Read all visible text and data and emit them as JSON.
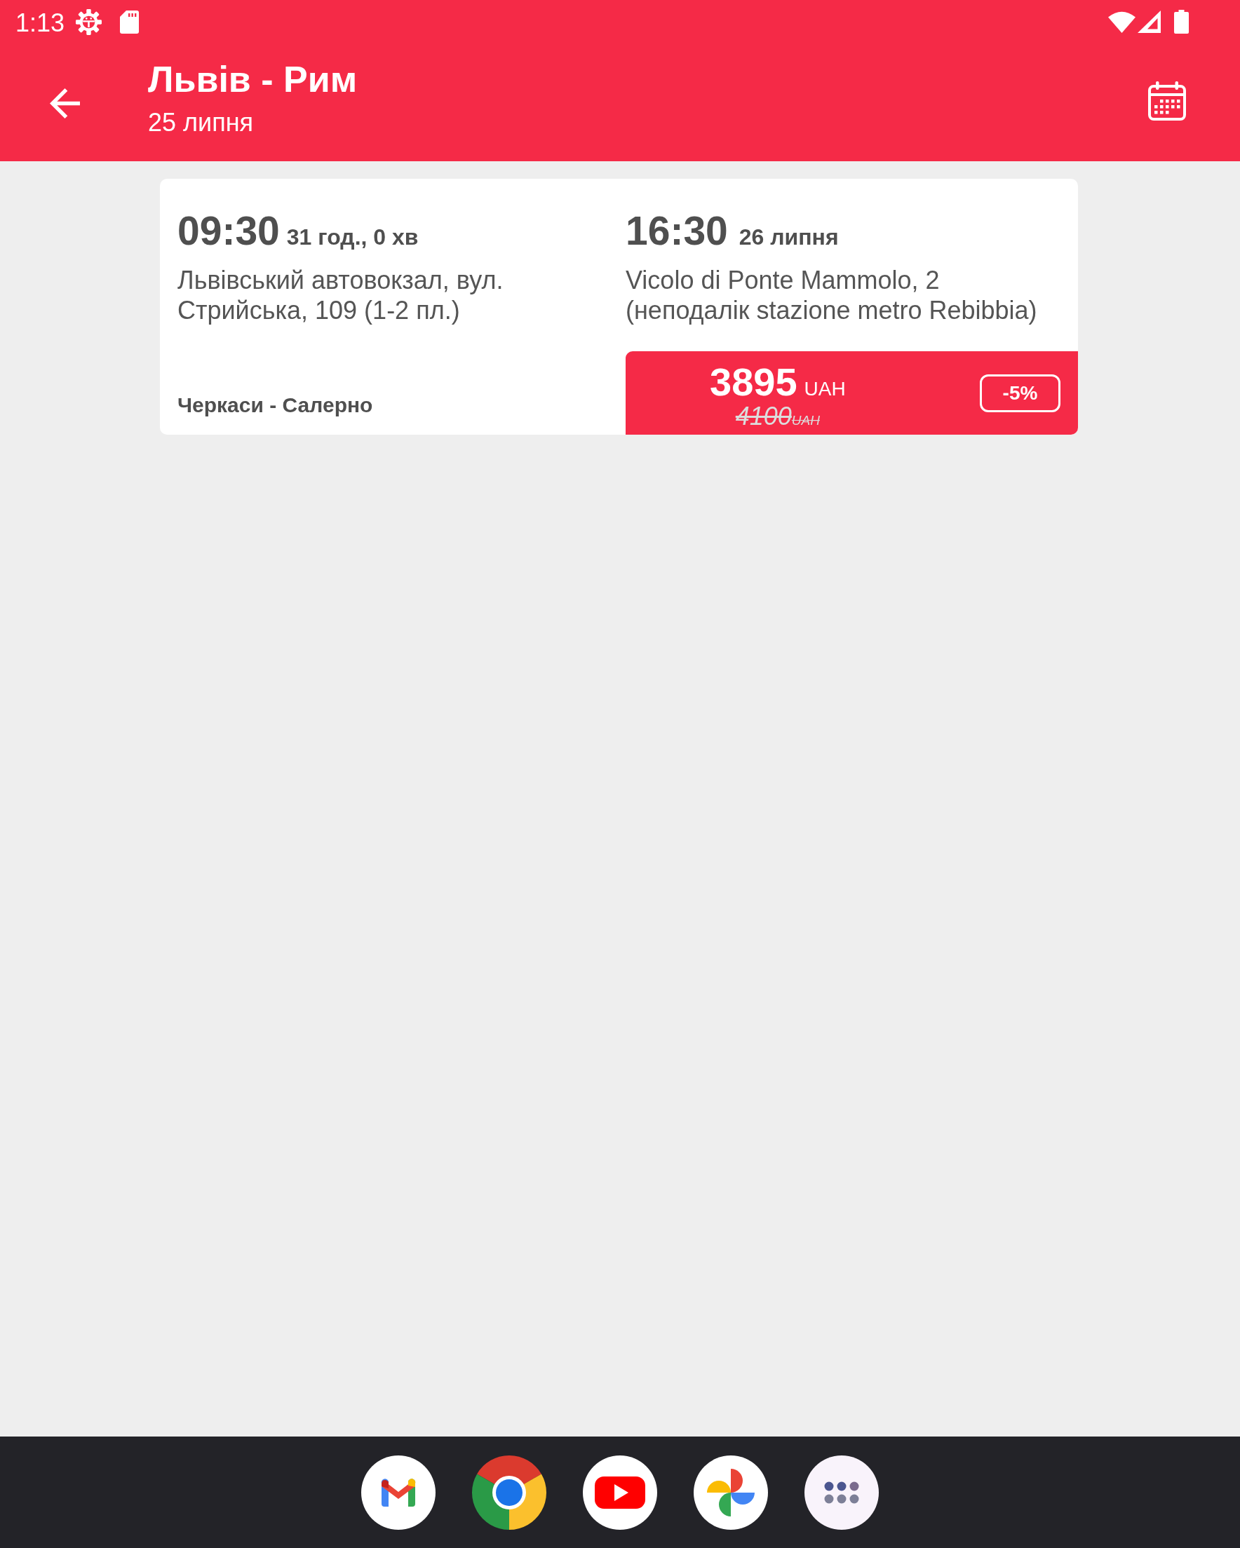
{
  "status_bar": {
    "time": "1:13"
  },
  "app_bar": {
    "title": "Львів - Рим",
    "subtitle": "25 липня"
  },
  "trips": [
    {
      "departure": {
        "time": "09:30",
        "note": "31 год., 0 хв",
        "address": "Львівський автовокзал, вул. Стрийська, 109 (1-2 пл.)"
      },
      "arrival": {
        "time": "16:30",
        "note": "26 липня",
        "address": "Vicolo di Ponte Mammolo, 2 (неподалік stazione metro Rebibbia)"
      },
      "route": "Черкаси - Салерно",
      "price": {
        "amount": "3895",
        "currency": "UAH",
        "old_amount": "4100",
        "old_currency": "UAH",
        "discount": "-5%"
      }
    }
  ]
}
